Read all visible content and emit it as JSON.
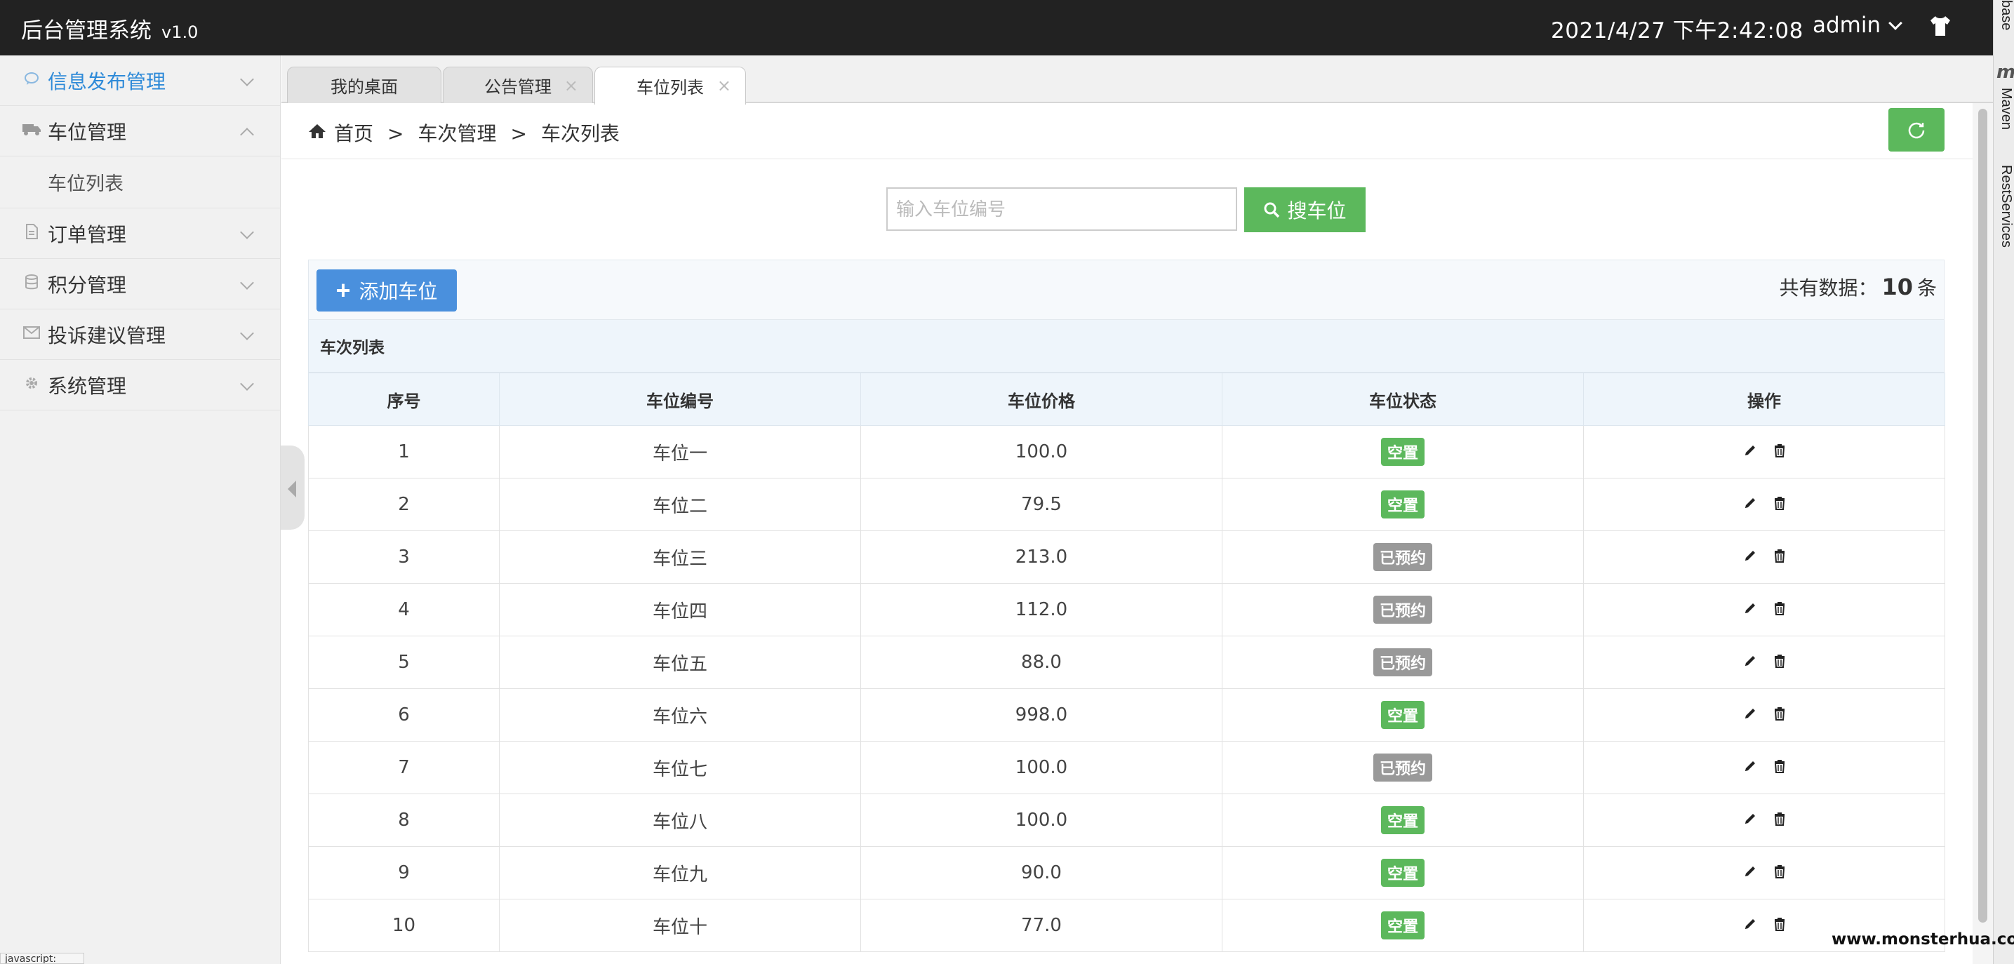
{
  "header": {
    "brand": "后台管理系统",
    "version": "v1.0",
    "datetime": "2021/4/27 下午2:42:08",
    "user": "admin",
    "theme_icon": "shirt-icon"
  },
  "ide": {
    "labels": [
      "base",
      "Maven",
      "RestServices"
    ],
    "m_glyph": "m"
  },
  "sidebar": {
    "items": [
      {
        "label": "信息发布管理",
        "icon": "comment-icon",
        "active": true
      },
      {
        "label": "车位管理",
        "icon": "truck-icon",
        "expanded": true
      },
      {
        "label": "订单管理",
        "icon": "file-icon"
      },
      {
        "label": "积分管理",
        "icon": "database-icon"
      },
      {
        "label": "投诉建议管理",
        "icon": "envelope-icon"
      },
      {
        "label": "系统管理",
        "icon": "gear-icon"
      }
    ],
    "sub_items": [
      {
        "label": "车位列表"
      }
    ]
  },
  "tabs": [
    {
      "label": "我的桌面",
      "closable": false
    },
    {
      "label": "公告管理",
      "closable": true
    },
    {
      "label": "车位列表",
      "closable": true,
      "active": true
    }
  ],
  "breadcrumb": {
    "home": "首页",
    "sep": ">",
    "level1": "车次管理",
    "level2": "车次列表"
  },
  "search": {
    "placeholder": "输入车位编号",
    "value": "",
    "button": "搜车位"
  },
  "toolbar": {
    "add_button": "添加车位",
    "count_prefix": "共有数据：",
    "count": "10",
    "count_suffix": "条"
  },
  "table": {
    "title": "车次列表",
    "columns": [
      "序号",
      "车位编号",
      "车位价格",
      "车位状态",
      "操作"
    ],
    "rows": [
      {
        "no": "1",
        "code": "车位一",
        "price": "100.0",
        "status": "空置"
      },
      {
        "no": "2",
        "code": "车位二",
        "price": "79.5",
        "status": "空置"
      },
      {
        "no": "3",
        "code": "车位三",
        "price": "213.0",
        "status": "已预约"
      },
      {
        "no": "4",
        "code": "车位四",
        "price": "112.0",
        "status": "已预约"
      },
      {
        "no": "5",
        "code": "车位五",
        "price": "88.0",
        "status": "已预约"
      },
      {
        "no": "6",
        "code": "车位六",
        "price": "998.0",
        "status": "空置"
      },
      {
        "no": "7",
        "code": "车位七",
        "price": "100.0",
        "status": "已预约"
      },
      {
        "no": "8",
        "code": "车位八",
        "price": "100.0",
        "status": "空置"
      },
      {
        "no": "9",
        "code": "车位九",
        "price": "90.0",
        "status": "空置"
      },
      {
        "no": "10",
        "code": "车位十",
        "price": "77.0",
        "status": "空置"
      }
    ]
  },
  "colors": {
    "header_bg": "#222222",
    "accent": "#2e8ad8",
    "success": "#5cb85c",
    "primary": "#4a90dd",
    "muted_badge": "#999999"
  },
  "watermark": "www.monsterhua.com",
  "status_bar": "javascript:"
}
